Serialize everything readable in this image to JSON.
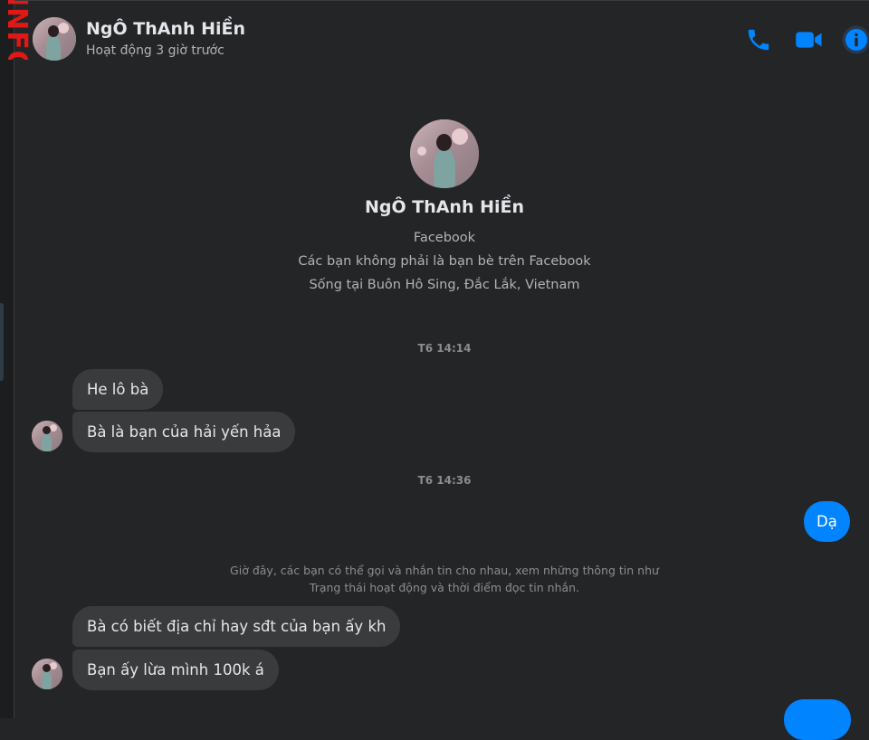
{
  "contact": {
    "name": "NgÔ ThAnh HiỀn",
    "status": "Hoạt động 3 giờ trước",
    "source": "Facebook",
    "relation": "Các bạn không phải là bạn bè trên Facebook",
    "location": "Sống tại Buôn Hô Sing, Đắc Lắk, Vietnam"
  },
  "watermark": {
    "text": "INFO"
  },
  "header_actions": [
    {
      "name": "call",
      "icon": "phone-icon"
    },
    {
      "name": "video",
      "icon": "video-camera-icon"
    },
    {
      "name": "info",
      "icon": "info-icon"
    }
  ],
  "colors": {
    "background": "#242526",
    "incoming_bubble": "#3a3b3c",
    "outgoing_bubble": "#0084ff",
    "accent": "#0084ff",
    "watermark": "#e01818"
  },
  "conversation": {
    "timestamps": [
      "T6 14:14",
      "T6 14:36"
    ],
    "group1": [
      "He lô bà",
      "Bà là bạn của hải yến hảa"
    ],
    "outgoing1": "Dạ",
    "notice": "Giờ đây, các bạn có thể gọi và nhắn tin cho nhau, xem những thông tin như Trạng thái hoạt động và thời điểm đọc tin nhắn.",
    "group2": [
      "Bà có biết địa chỉ hay sđt của bạn ấy kh",
      "Bạn ấy lừa mình 100k á"
    ],
    "outgoing2": ""
  }
}
